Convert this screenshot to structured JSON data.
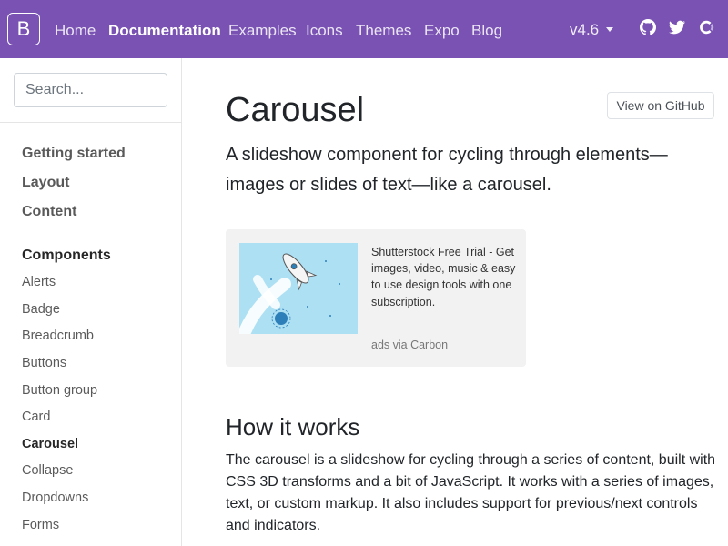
{
  "navbar": {
    "brand": "B",
    "links": [
      "Home",
      "Documentation",
      "Examples",
      "Icons",
      "Themes",
      "Expo",
      "Blog"
    ],
    "active": "Documentation",
    "version": "v4.6",
    "background": "#7952b3"
  },
  "sidebar": {
    "search_placeholder": "Search...",
    "groups": [
      "Getting started",
      "Layout",
      "Content",
      "Components"
    ],
    "items": [
      "Alerts",
      "Badge",
      "Breadcrumb",
      "Buttons",
      "Button group",
      "Card",
      "Carousel",
      "Collapse",
      "Dropdowns",
      "Forms"
    ],
    "current_item": "Carousel"
  },
  "main": {
    "title": "Carousel",
    "github_button": "View on GitHub",
    "lead": "A slideshow component for cycling through elements—images or slides of text—like a carousel.",
    "ad": {
      "text": "Shutterstock Free Trial - Get images, video, music & easy to use design tools with one subscription.",
      "powered_by": "ads via Carbon"
    },
    "section_title": "How it works",
    "section_body": "The carousel is a slideshow for cycling through a series of content, built with CSS 3D transforms and a bit of JavaScript. It works with a series of images, text, or custom markup. It also includes support for previous/next controls and indicators."
  },
  "icons": {
    "github": "github-icon",
    "twitter": "twitter-icon",
    "opencollective": "opencollective-icon",
    "caret": "caret-down-icon"
  }
}
